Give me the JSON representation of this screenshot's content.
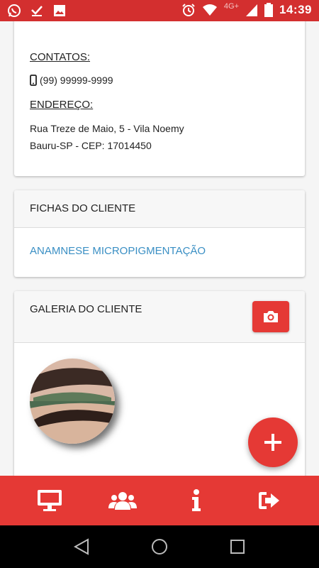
{
  "status_bar": {
    "time": "14:39",
    "network": "4G+",
    "left_icons": [
      "whatsapp-icon",
      "download-done-icon",
      "image-icon"
    ],
    "right_icons": [
      "alarm-icon",
      "wifi-icon",
      "battery-icon"
    ]
  },
  "contact_card": {
    "contacts_label": "CONTATOS:",
    "phone": "(99) 99999-9999",
    "address_label": "ENDEREÇO:",
    "address_line1": "Rua Treze de Maio, 5 - Vila Noemy",
    "address_line2": "Bauru-SP - CEP: 17014450"
  },
  "fichas_card": {
    "title": "FICHAS DO CLIENTE",
    "link": "ANAMNESE MICROPIGMENTAÇÃO"
  },
  "galeria_card": {
    "title": "GALERIA DO CLIENTE",
    "camera_icon": "camera-icon",
    "photo": "eyebrow-before-after-photo"
  },
  "fab": {
    "icon": "plus-icon"
  },
  "bottom_nav": [
    {
      "icon": "desktop-icon"
    },
    {
      "icon": "users-icon"
    },
    {
      "icon": "info-icon"
    },
    {
      "icon": "sign-out-icon"
    }
  ],
  "system_nav": [
    "back-icon",
    "home-icon",
    "recents-icon"
  ],
  "colors": {
    "primary": "#e53935",
    "status_bar": "#d32f2f",
    "link": "#3a8fc4",
    "background": "#f5f5f5"
  }
}
